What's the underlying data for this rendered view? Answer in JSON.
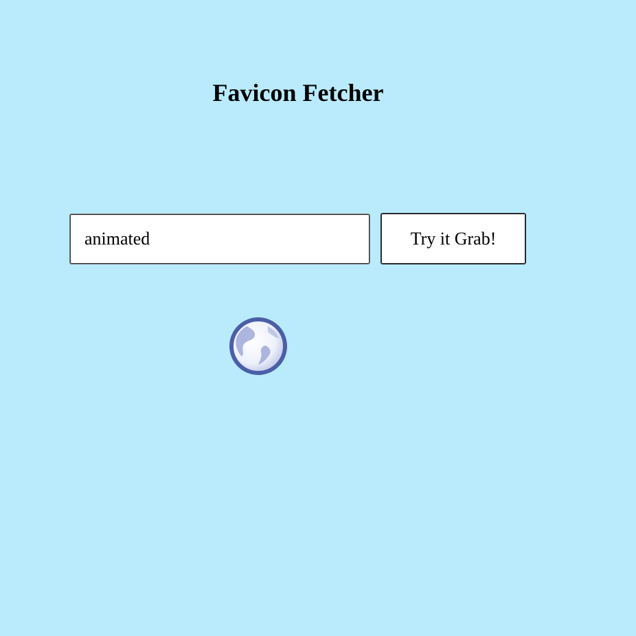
{
  "header": {
    "title": "Favicon Fetcher"
  },
  "search": {
    "value": "animated",
    "placeholder": ""
  },
  "actions": {
    "grab_label": "Try it Grab!"
  },
  "result": {
    "icon": "globe-icon",
    "colors": {
      "outline": "#4a5fa8",
      "fill": "#eef1fb",
      "land": "#9fa9d8"
    }
  },
  "theme": {
    "background": "#b9ebfd"
  }
}
